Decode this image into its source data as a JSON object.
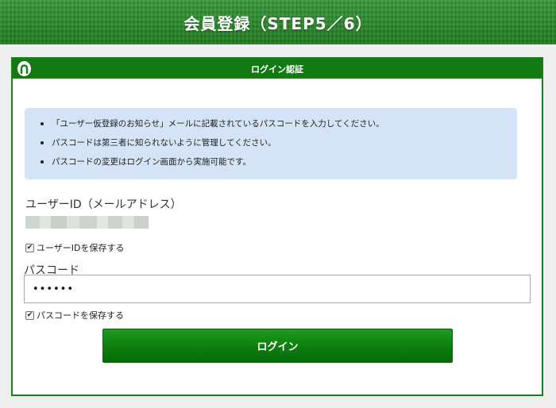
{
  "header": {
    "title": "会員登録（STEP5／6）"
  },
  "panel": {
    "title": "ログイン認証",
    "icon": "horseshoe-icon"
  },
  "info": {
    "items": [
      "「ユーザー仮登録のお知らせ」メールに記載されているパスコードを入力してください。",
      "パスコードは第三者に知られないように管理してください。",
      "パスコードの変更はログイン画面から実施可能です。"
    ]
  },
  "form": {
    "userid_label": "ユーザーID（メールアドレス）",
    "save_userid_label": "ユーザーIDを保存する",
    "save_userid_checked": true,
    "passcode_label": "パスコード",
    "passcode_value": "••••••",
    "save_passcode_label": "パスコードを保存する",
    "save_passcode_checked": true,
    "login_button": "ログイン"
  },
  "colors": {
    "header_green": "#2b8a2b",
    "panel_border": "#1b7d1b",
    "info_bg": "#d4e3f5",
    "button_green": "#0d7e0d"
  }
}
